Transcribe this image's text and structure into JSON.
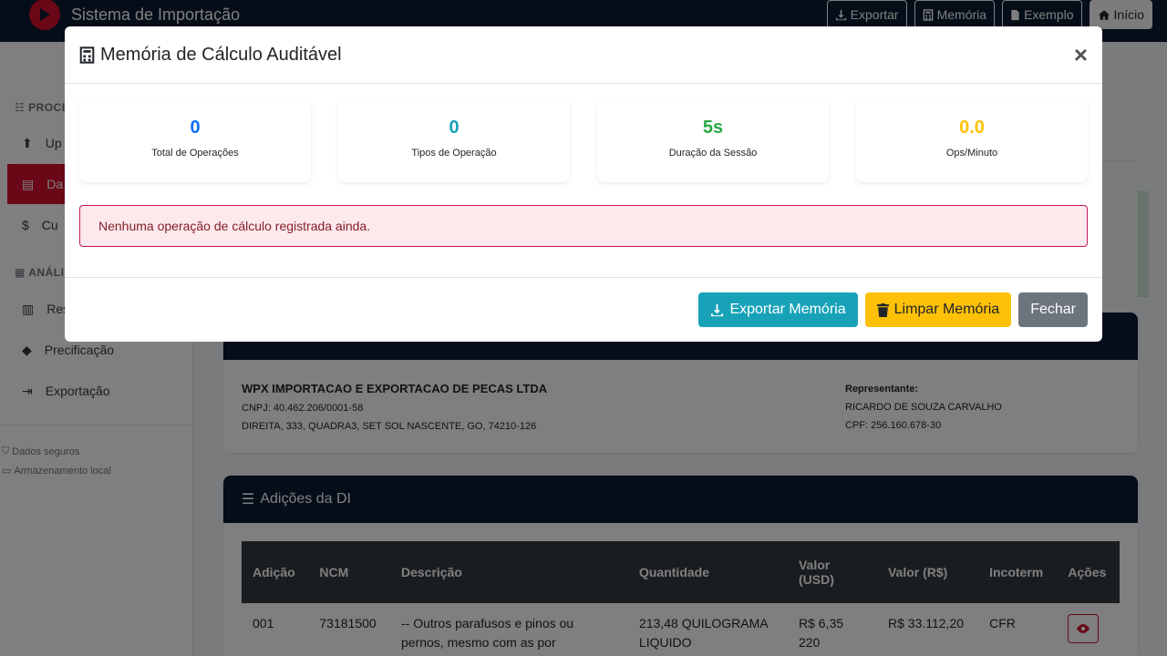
{
  "app": {
    "title": "Sistema de Importação",
    "nav": [
      {
        "label": "Exportar",
        "icon": "download-icon"
      },
      {
        "label": "Memória",
        "icon": "calculator-icon"
      },
      {
        "label": "Exemplo",
        "icon": "file-icon"
      },
      {
        "label": "Início",
        "icon": "home-icon"
      }
    ]
  },
  "sidebar": {
    "section_process": "PROCE",
    "section_analysis": "ANÁLIS",
    "items": [
      {
        "label": "Up",
        "icon": "upload-icon"
      },
      {
        "label": "Da",
        "icon": "document-icon"
      },
      {
        "label": "Cu",
        "icon": "dollar-icon"
      },
      {
        "label": "Res",
        "icon": "chart-icon"
      },
      {
        "label": "Precificação",
        "icon": "tags-icon"
      },
      {
        "label": "Exportação",
        "icon": "export-icon"
      }
    ],
    "notes": [
      "Dados seguros",
      "Armazenamento local"
    ]
  },
  "importer": {
    "name": "WPX IMPORTACAO E EXPORTACAO DE PECAS LTDA",
    "cnpj": "CNPJ: 40.462.206/0001-58",
    "address": "DIREITA, 333, QUADRA3, SET SOL NASCENTE, GO, 74210-126",
    "rep_label": "Representante:",
    "rep_name": "RICARDO DE SOUZA CARVALHO",
    "rep_cpf": "CPF: 256.160.678-30"
  },
  "adicoes": {
    "title": "Adições da DI",
    "columns": [
      "Adição",
      "NCM",
      "Descrição",
      "Quantidade",
      "Valor (USD)",
      "Valor (R$)",
      "Incoterm",
      "Ações"
    ],
    "rows": [
      {
        "adicao": "001",
        "ncm": "73181500",
        "descricao": "-- Outros parafusos e pinos ou pernos, mesmo com as por",
        "quantidade": "213,48 QUILOGRAMA LIQUIDO",
        "valor_usd": "R$ 6,35 220",
        "valor_brl": "R$ 33.112,20",
        "incoterm": "CFR"
      }
    ]
  },
  "modal": {
    "title": "Memória de Cálculo Auditável",
    "stats": [
      {
        "value": "0",
        "label": "Total de Operações",
        "color": "#0d6efd"
      },
      {
        "value": "0",
        "label": "Tipos de Operação",
        "color": "#17a2b8"
      },
      {
        "value": "5s",
        "label": "Duração da Sessão",
        "color": "#28a745"
      },
      {
        "value": "0.0",
        "label": "Ops/Minuto",
        "color": "#ffc107"
      }
    ],
    "alert": "Nenhuma operação de cálculo registrada ainda.",
    "buttons": {
      "export": "Exportar Memória",
      "clear": "Limpar Memória",
      "close": "Fechar"
    }
  }
}
